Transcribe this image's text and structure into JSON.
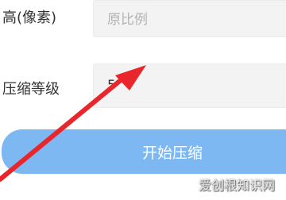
{
  "form": {
    "height_label": "高(像素)",
    "height_placeholder": "原比例",
    "compress_label": "压缩等级",
    "compress_value": "5"
  },
  "actions": {
    "start_label": "开始压缩"
  },
  "watermark": {
    "text": "爱创根知识网"
  },
  "colors": {
    "button": "#7db8f3",
    "arrow": "#e8262b",
    "field_bg": "#f3f3f3"
  }
}
